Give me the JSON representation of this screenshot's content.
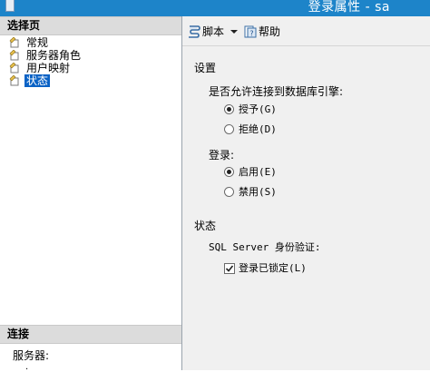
{
  "window": {
    "title": "登录属性 - sa"
  },
  "left_pane": {
    "pages_header": "选择页",
    "pages": [
      {
        "label": "常规",
        "icon": "page-icon"
      },
      {
        "label": "服务器角色",
        "icon": "page-icon"
      },
      {
        "label": "用户映射",
        "icon": "page-icon"
      },
      {
        "label": "状态",
        "icon": "page-icon",
        "selected": true
      }
    ],
    "connect_header": "连接",
    "server_label": "服务器:",
    "server_value": "."
  },
  "toolbar": {
    "script_label": "脚本",
    "help_label": "帮助"
  },
  "settings": {
    "section_label": "设置",
    "connect_question": "是否允许连接到数据库引擎:",
    "grant_label": "授予(G)",
    "deny_label": "拒绝(D)",
    "grant_selected": true,
    "login_label": "登录:",
    "enabled_label": "启用(E)",
    "disabled_label": "禁用(S)",
    "enabled_selected": true
  },
  "status": {
    "section_label": "状态",
    "auth_label": "SQL Server 身份验证:",
    "locked_label": "登录已锁定(L)",
    "locked_checked": true
  },
  "colors": {
    "titlebar": "#1d84c9",
    "selection": "#0a62c5",
    "panel": "#f0f0f0",
    "header": "#dcdcdc"
  }
}
